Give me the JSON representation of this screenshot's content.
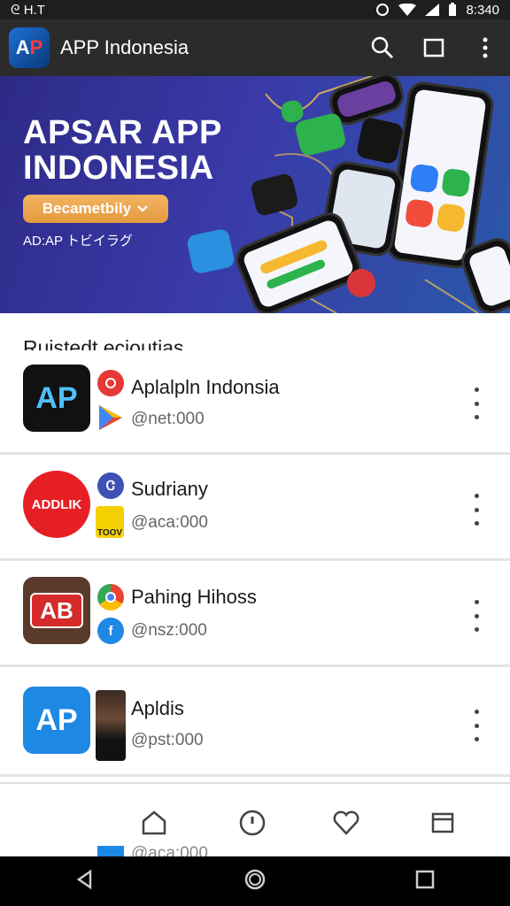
{
  "status_bar": {
    "left_text": "ᘓ  H.T",
    "time": "8:340"
  },
  "app_bar": {
    "logo_a": "A",
    "logo_p": "P",
    "title": "APP Indonesia"
  },
  "banner": {
    "title_line1": "APSAR APP",
    "title_line2": "INDONESIA",
    "button_label": "Becametbily",
    "subtitle": "AD:AP トビイラグ"
  },
  "section": {
    "title": "Ruistedt ecioutias"
  },
  "items": [
    {
      "icon_text": "AP",
      "name": "Aplalpln Indonsia",
      "meta": "@net:000"
    },
    {
      "icon_text": "ADDLIK",
      "name": "Sudriany",
      "meta": "@aca:000",
      "badge_text": "Ꮳ",
      "sq_text": "TOOV"
    },
    {
      "icon_text": "AB",
      "name": "Pahing Hihoss",
      "meta": "@nsz:000",
      "badge_text": "f"
    },
    {
      "icon_text": "AP",
      "name": "Apldis",
      "meta": "@pst:000"
    }
  ],
  "peek_item": {
    "meta": "@aca:000"
  },
  "colors": {
    "accent_orange": "#e49a3e",
    "banner_blue": "#3a3aa8",
    "app_bar": "#2b2b2b"
  }
}
